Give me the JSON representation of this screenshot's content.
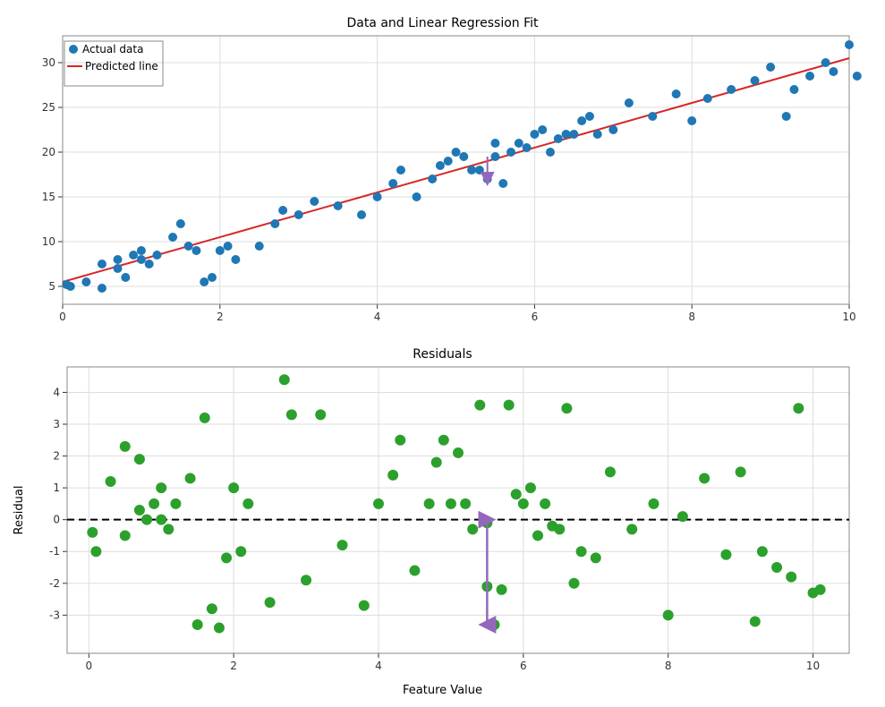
{
  "top_chart": {
    "title": "Data and Linear Regression Fit",
    "legend": {
      "actual": "Actual data",
      "predicted": "Predicted line"
    },
    "x_label": "",
    "x_ticks": [
      0,
      2,
      4,
      6,
      8,
      10
    ],
    "y_ticks": [
      5,
      10,
      15,
      20,
      25,
      30
    ],
    "actual_color": "#1f77b4",
    "predicted_color": "#d62728",
    "arrow_color": "#9467bd",
    "points": [
      [
        0.05,
        5.2
      ],
      [
        0.1,
        5.0
      ],
      [
        0.3,
        5.5
      ],
      [
        0.5,
        4.8
      ],
      [
        0.5,
        7.5
      ],
      [
        0.7,
        7.0
      ],
      [
        0.7,
        8.0
      ],
      [
        0.8,
        6.0
      ],
      [
        0.9,
        8.5
      ],
      [
        1.0,
        9.0
      ],
      [
        1.0,
        8.0
      ],
      [
        1.1,
        7.5
      ],
      [
        1.2,
        8.5
      ],
      [
        1.4,
        10.5
      ],
      [
        1.5,
        12.0
      ],
      [
        1.6,
        9.5
      ],
      [
        1.7,
        9.0
      ],
      [
        1.8,
        5.5
      ],
      [
        1.9,
        6.0
      ],
      [
        2.0,
        9.0
      ],
      [
        2.1,
        9.5
      ],
      [
        2.2,
        8.0
      ],
      [
        2.5,
        9.5
      ],
      [
        2.7,
        12.0
      ],
      [
        2.8,
        13.5
      ],
      [
        3.0,
        13.0
      ],
      [
        3.2,
        14.5
      ],
      [
        3.5,
        14.0
      ],
      [
        3.8,
        13.0
      ],
      [
        4.0,
        15.0
      ],
      [
        4.2,
        16.5
      ],
      [
        4.3,
        18.0
      ],
      [
        4.5,
        15.0
      ],
      [
        4.7,
        17.0
      ],
      [
        4.8,
        18.5
      ],
      [
        4.9,
        19.0
      ],
      [
        5.0,
        20.0
      ],
      [
        5.1,
        19.5
      ],
      [
        5.2,
        18.0
      ],
      [
        5.3,
        18.0
      ],
      [
        5.4,
        17.0
      ],
      [
        5.5,
        19.5
      ],
      [
        5.5,
        21.0
      ],
      [
        5.6,
        16.5
      ],
      [
        5.7,
        20.0
      ],
      [
        5.8,
        21.0
      ],
      [
        5.9,
        20.5
      ],
      [
        6.0,
        22.0
      ],
      [
        6.1,
        22.5
      ],
      [
        6.2,
        20.0
      ],
      [
        6.3,
        21.5
      ],
      [
        6.4,
        22.0
      ],
      [
        6.5,
        22.0
      ],
      [
        6.6,
        23.5
      ],
      [
        6.7,
        24.0
      ],
      [
        6.8,
        22.0
      ],
      [
        7.0,
        22.5
      ],
      [
        7.2,
        25.5
      ],
      [
        7.5,
        24.0
      ],
      [
        7.8,
        26.5
      ],
      [
        8.0,
        23.5
      ],
      [
        8.2,
        26.0
      ],
      [
        8.5,
        27.0
      ],
      [
        8.8,
        28.0
      ],
      [
        9.0,
        29.5
      ],
      [
        9.2,
        24.0
      ],
      [
        9.3,
        27.0
      ],
      [
        9.5,
        28.5
      ],
      [
        9.7,
        30.0
      ],
      [
        9.8,
        29.0
      ],
      [
        10.0,
        32.0
      ],
      [
        10.1,
        28.5
      ]
    ],
    "line_start": [
      0,
      5.5
    ],
    "line_end": [
      10,
      30.5
    ],
    "arrow_x": 5.4,
    "arrow_y1": 19.5,
    "arrow_y2": 17.0
  },
  "bottom_chart": {
    "title": "Residuals",
    "x_label": "Feature Value",
    "y_label": "Residual",
    "x_ticks": [
      0,
      2,
      4,
      6,
      8,
      10
    ],
    "y_ticks": [
      -3,
      -2,
      -1,
      0,
      1,
      2,
      3,
      4
    ],
    "dot_color": "#2ca02c",
    "arrow_color": "#9467bd",
    "points": [
      [
        0.05,
        -0.4
      ],
      [
        0.1,
        -1.0
      ],
      [
        0.3,
        1.2
      ],
      [
        0.5,
        -0.5
      ],
      [
        0.5,
        2.3
      ],
      [
        0.7,
        0.3
      ],
      [
        0.7,
        1.9
      ],
      [
        0.8,
        0.0
      ],
      [
        0.9,
        0.5
      ],
      [
        1.0,
        1.0
      ],
      [
        1.0,
        0.0
      ],
      [
        1.1,
        -0.3
      ],
      [
        1.2,
        0.5
      ],
      [
        1.4,
        1.3
      ],
      [
        1.5,
        -3.3
      ],
      [
        1.6,
        3.2
      ],
      [
        1.7,
        -2.8
      ],
      [
        1.8,
        -3.4
      ],
      [
        1.9,
        -1.2
      ],
      [
        2.0,
        1.0
      ],
      [
        2.1,
        -1.0
      ],
      [
        2.2,
        0.5
      ],
      [
        2.5,
        -2.6
      ],
      [
        2.7,
        4.4
      ],
      [
        2.8,
        3.3
      ],
      [
        3.0,
        -1.9
      ],
      [
        3.2,
        3.3
      ],
      [
        3.5,
        -0.8
      ],
      [
        3.8,
        -2.7
      ],
      [
        4.0,
        0.5
      ],
      [
        4.2,
        1.4
      ],
      [
        4.3,
        2.5
      ],
      [
        4.5,
        -1.6
      ],
      [
        4.7,
        0.5
      ],
      [
        4.8,
        1.8
      ],
      [
        4.9,
        2.5
      ],
      [
        5.0,
        0.5
      ],
      [
        5.1,
        2.1
      ],
      [
        5.2,
        0.5
      ],
      [
        5.3,
        -0.3
      ],
      [
        5.4,
        3.6
      ],
      [
        5.5,
        -0.1
      ],
      [
        5.5,
        -2.1
      ],
      [
        5.6,
        -3.3
      ],
      [
        5.7,
        -2.2
      ],
      [
        5.8,
        3.6
      ],
      [
        5.9,
        0.8
      ],
      [
        6.0,
        0.5
      ],
      [
        6.1,
        1.0
      ],
      [
        6.2,
        -0.5
      ],
      [
        6.3,
        0.5
      ],
      [
        6.4,
        -0.2
      ],
      [
        6.5,
        -0.3
      ],
      [
        6.6,
        3.5
      ],
      [
        6.7,
        -2.0
      ],
      [
        6.8,
        -1.0
      ],
      [
        7.0,
        -1.2
      ],
      [
        7.2,
        1.5
      ],
      [
        7.5,
        -0.3
      ],
      [
        7.8,
        0.5
      ],
      [
        8.0,
        -3.0
      ],
      [
        8.2,
        0.1
      ],
      [
        8.5,
        1.3
      ],
      [
        8.8,
        -1.1
      ],
      [
        9.0,
        1.5
      ],
      [
        9.2,
        -3.2
      ],
      [
        9.3,
        -1.0
      ],
      [
        9.5,
        -1.5
      ],
      [
        9.7,
        -1.8
      ],
      [
        9.8,
        3.5
      ],
      [
        10.0,
        -2.3
      ],
      [
        10.1,
        -2.2
      ]
    ],
    "arrow_x": 5.5,
    "arrow_y1": 0,
    "arrow_y2": -3.3
  }
}
